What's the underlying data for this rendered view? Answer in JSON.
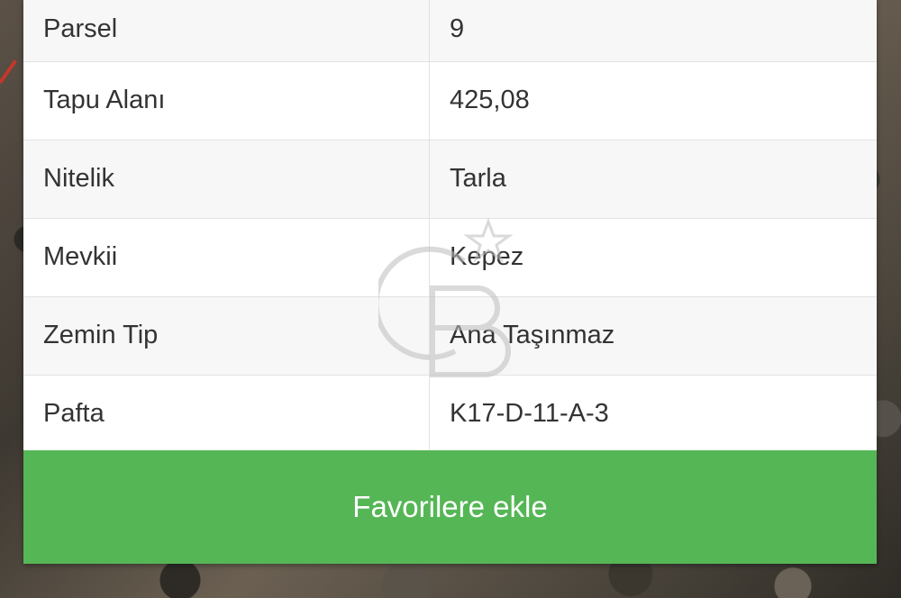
{
  "table": {
    "rows": [
      {
        "label": "Parsel",
        "value": "9"
      },
      {
        "label": "Tapu Alanı",
        "value": "425,08"
      },
      {
        "label": "Nitelik",
        "value": "Tarla"
      },
      {
        "label": "Mevkii",
        "value": "Kepez"
      },
      {
        "label": "Zemin Tip",
        "value": "Ana Taşınmaz"
      },
      {
        "label": "Pafta",
        "value": "K17-D-11-A-3"
      }
    ]
  },
  "actions": {
    "favorite_label": "Favorilere ekle"
  },
  "colors": {
    "button_bg": "#55b655",
    "row_alt_bg": "#f7f7f7",
    "text": "#333333"
  },
  "watermark": {
    "icon": "gb-logo-star-icon",
    "text": "GB"
  }
}
